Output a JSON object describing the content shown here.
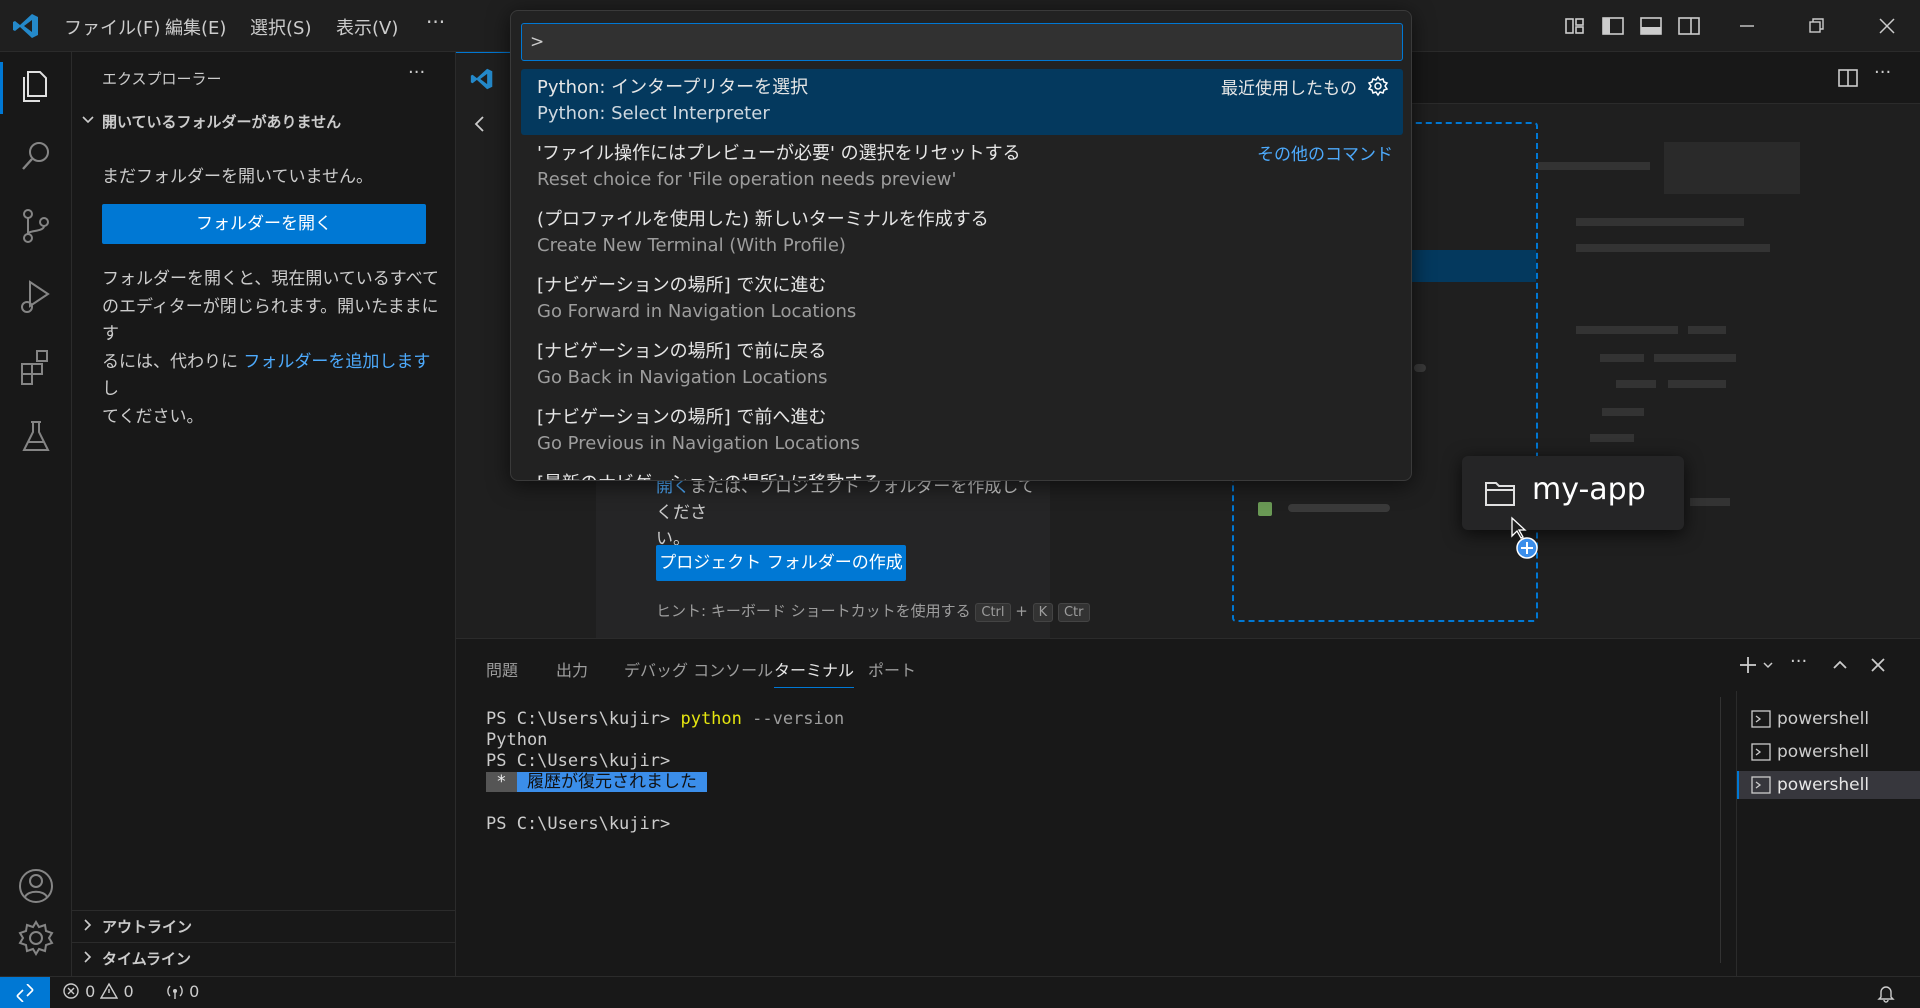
{
  "titlebar": {
    "menus": [
      "ファイル(F)",
      "編集(E)",
      "選択(S)",
      "表示(V)"
    ],
    "more": "···"
  },
  "sidebar": {
    "title": "エクスプローラー",
    "section": "開いているフォルダーがありません",
    "no_folder_text": "まだフォルダーを開いていません。",
    "open_folder_button": "フォルダーを開く",
    "info_line1": "フォルダーを開くと、現在開いているすべて",
    "info_line2": "のエディターが閉じられます。開いたままにす",
    "info_line3_pre": "るには、代わりに ",
    "info_link": "フォルダーを追加します",
    "info_line3_post": " し",
    "info_line4": "てください。",
    "outline": "アウトライン",
    "timeline": "タイムライン"
  },
  "editor": {
    "welcome_partial_link": "開く",
    "welcome_partial_text": "または、プロジェクト フォルダーを作成してくださ",
    "welcome_partial_text2": "い。",
    "create_project_button": "プロジェクト フォルダーの作成",
    "hint_text": "ヒント: キーボード ショートカットを使用する",
    "key_ctrl": "Ctrl",
    "key_plus": "+",
    "key_k": "K",
    "key_ctrl2": "Ctr"
  },
  "palette": {
    "input_value": ">",
    "recently_used": "最近使用したもの",
    "other_commands": "その他のコマンド",
    "items": [
      {
        "label": "Python: インタープリターを選択",
        "detail": "Python: Select Interpreter"
      },
      {
        "label": "'ファイル操作にはプレビューが必要' の選択をリセットする",
        "detail": "Reset choice for 'File operation needs preview'"
      },
      {
        "label": "(プロファイルを使用した) 新しいターミナルを作成する",
        "detail": "Create New Terminal (With Profile)"
      },
      {
        "label": "[ナビゲーションの場所] で次に進む",
        "detail": "Go Forward in Navigation Locations"
      },
      {
        "label": "[ナビゲーションの場所] で前に戻る",
        "detail": "Go Back in Navigation Locations"
      },
      {
        "label": "[ナビゲーションの場所] で前へ進む",
        "detail": "Go Previous in Navigation Locations"
      },
      {
        "label": "[最新のナビゲーションの場所] に移動する",
        "detail": ""
      }
    ]
  },
  "drag_preview": {
    "folder_name": "my-app"
  },
  "panel": {
    "tabs": [
      "問題",
      "出力",
      "デバッグ コンソール",
      "ターミナル",
      "ポート"
    ],
    "active_tab": "ターミナル",
    "terminal": {
      "line1_prompt": "PS C:\\Users\\kujir> ",
      "line1_cmd": "python",
      "line1_args": " --version",
      "line2": "Python",
      "line3": "PS C:\\Users\\kujir>",
      "restore_star": " * ",
      "restore_text": " 履歴が復元されました ",
      "line5": "PS C:\\Users\\kujir>"
    },
    "terminal_list": [
      "powershell",
      "powershell",
      "powershell"
    ]
  },
  "statusbar": {
    "errors": "0",
    "warnings": "0",
    "ports": "0"
  },
  "colors": {
    "accent": "#0078d4",
    "link": "#4daafc",
    "terminal_cmd": "#e5e510"
  }
}
